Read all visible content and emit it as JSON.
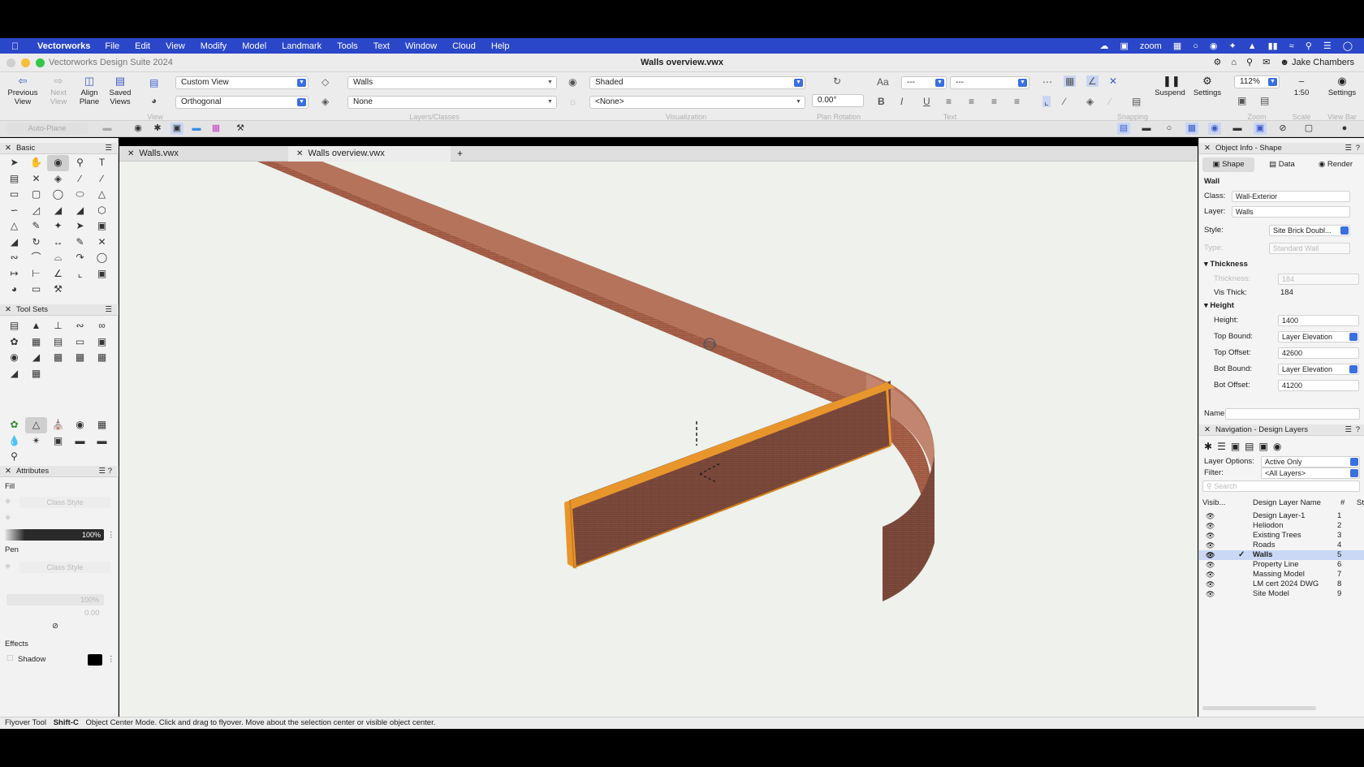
{
  "menubar": {
    "app_name": "Vectorworks",
    "items": [
      "File",
      "Edit",
      "View",
      "Modify",
      "Model",
      "Landmark",
      "Tools",
      "Text",
      "Window",
      "Cloud",
      "Help"
    ],
    "zoom_label": "zoom"
  },
  "window": {
    "suite_title": "Vectorworks Design Suite 2024",
    "document_title": "Walls overview.vwx",
    "user_name": "Jake Chambers"
  },
  "toolbar": {
    "previous_view": "Previous View",
    "next_view": "Next View",
    "align_plane": "Align Plane",
    "saved_views": "Saved Views",
    "view_label": "View",
    "view_dropdown": "Custom View",
    "projection_dropdown": "Orthogonal",
    "layer_dropdown": "Walls",
    "class_dropdown": "None",
    "layers_classes_label": "Layers/Classes",
    "render_dropdown": "Shaded",
    "lighting_dropdown": "<None>",
    "visualization_label": "Visualization",
    "plan_rotation_value": "0.00°",
    "plan_rotation_label": "Plan Rotation",
    "text_style": "Aa",
    "font_dropdown": "---",
    "size_dropdown": "---",
    "text_label": "Text",
    "snapping_label": "Snapping",
    "suspend": "Suspend",
    "settings": "Settings",
    "zoom_value": "112%",
    "zoom_label": "Zoom",
    "scale_value": "1:50",
    "scale_label": "Scale",
    "viewbar_settings": "Settings",
    "viewbar_label": "View Bar"
  },
  "toolbar2": {
    "auto_plane": "Auto-Plane"
  },
  "basic_palette": {
    "title": "Basic"
  },
  "toolsets_palette": {
    "title": "Tool Sets"
  },
  "attributes": {
    "title": "Attributes",
    "fill_label": "Fill",
    "fill_style": "Class Style",
    "fill_opacity": "100%",
    "pen_label": "Pen",
    "pen_style": "Class Style",
    "pen_opacity": "100%",
    "pen_thickness": "0.00",
    "effects_label": "Effects",
    "shadow_label": "Shadow"
  },
  "tabs": [
    {
      "label": "Walls.vwx"
    },
    {
      "label": "Walls overview.vwx"
    }
  ],
  "object_info": {
    "title": "Object Info - Shape",
    "tabs": [
      "Shape",
      "Data",
      "Render"
    ],
    "object_type": "Wall",
    "class_label": "Class:",
    "class_value": "Wall-Exterior",
    "layer_label": "Layer:",
    "layer_value": "Walls",
    "style_label": "Style:",
    "style_value": "Site Brick Doubl...",
    "type_label": "Type:",
    "type_value": "Standard Wall",
    "thickness_section": "Thickness",
    "thickness_label": "Thickness:",
    "thickness_value": "184",
    "vis_thick_label": "Vis Thick:",
    "vis_thick_value": "184",
    "height_section": "Height",
    "height_label": "Height:",
    "height_value": "1400",
    "top_bound_label": "Top Bound:",
    "top_bound_value": "Layer Elevation",
    "top_offset_label": "Top Offset:",
    "top_offset_value": "42600",
    "bot_bound_label": "Bot Bound:",
    "bot_bound_value": "Layer Elevation",
    "bot_offset_label": "Bot Offset:",
    "bot_offset_value": "41200",
    "name_label": "Name:"
  },
  "navigation": {
    "title": "Navigation - Design Layers",
    "layer_options_label": "Layer Options:",
    "layer_options_value": "Active Only",
    "filter_label": "Filter:",
    "filter_value": "<All Layers>",
    "search_placeholder": "Search",
    "col_visibility": "Visib...",
    "col_name": "Design Layer Name",
    "col_number": "#",
    "col_st": "St",
    "layers": [
      {
        "name": "Design Layer-1",
        "num": "1"
      },
      {
        "name": "Heliodon",
        "num": "2"
      },
      {
        "name": "Existing Trees",
        "num": "3"
      },
      {
        "name": "Roads",
        "num": "4"
      },
      {
        "name": "Walls",
        "num": "5",
        "active": true
      },
      {
        "name": "Property Line",
        "num": "6"
      },
      {
        "name": "Massing Model",
        "num": "7"
      },
      {
        "name": "LM cert 2024 DWG",
        "num": "8"
      },
      {
        "name": "Site Model",
        "num": "9"
      }
    ]
  },
  "status": {
    "tool": "Flyover Tool",
    "shortcut": "Shift-C",
    "message": "Object Center Mode. Click and drag to flyover.  Move about the selection center or visible object center."
  },
  "colors": {
    "menubar": "#2a46c9",
    "brick": "#a9624a",
    "selection": "#e8962c",
    "canvas": "#eef1ec"
  }
}
